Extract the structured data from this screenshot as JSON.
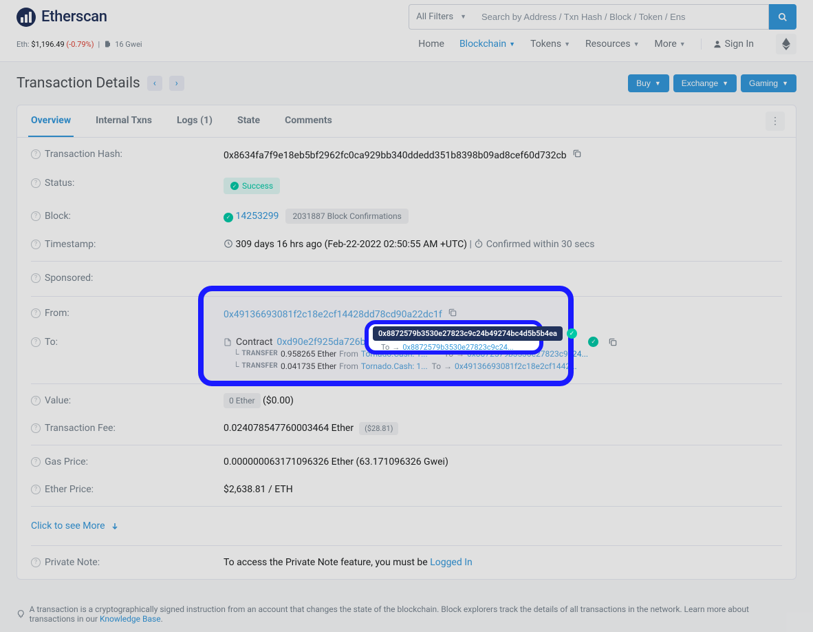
{
  "header": {
    "logo_text": "Etherscan",
    "filter_label": "All Filters",
    "search_placeholder": "Search by Address / Txn Hash / Block / Token / Ens",
    "eth_label": "Eth: ",
    "eth_price": "$1,196.49",
    "eth_change": "(-0.79%)",
    "gwei": "16 Gwei"
  },
  "nav": {
    "home": "Home",
    "blockchain": "Blockchain",
    "tokens": "Tokens",
    "resources": "Resources",
    "more": "More",
    "signin": "Sign In"
  },
  "page": {
    "title": "Transaction Details",
    "buy": "Buy",
    "exchange": "Exchange",
    "gaming": "Gaming"
  },
  "tabs": {
    "overview": "Overview",
    "internal": "Internal Txns",
    "logs": "Logs (1)",
    "state": "State",
    "comments": "Comments"
  },
  "labels": {
    "hash": "Transaction Hash:",
    "status": "Status:",
    "block": "Block:",
    "timestamp": "Timestamp:",
    "sponsored": "Sponsored:",
    "from": "From:",
    "to": "To:",
    "value": "Value:",
    "fee": "Transaction Fee:",
    "gas": "Gas Price:",
    "ether_price": "Ether Price:",
    "private_note": "Private Note:"
  },
  "values": {
    "hash": "0x8634fa7f9e18eb5bf2962fc0ca929bb340ddedd351b8398b09ad8cef60d732cb",
    "status": "Success",
    "block": "14253299",
    "confirmations": "2031887 Block Confirmations",
    "timestamp_main": "309 days 16 hrs ago (Feb-22-2022 02:50:55 AM +UTC)",
    "confirmed_within": "Confirmed within 30 secs",
    "from": "0x49136693081f2c18e2cf14428dd78cd90a22dc1f",
    "contract_label": "Contract",
    "contract_addr": "0xd90e2f925da726b50c4ed8d",
    "transfer1_amount": "0.958265 Ether",
    "transfer1_from_label": "From",
    "transfer1_from": "Tornado.Cash: 1...",
    "transfer1_to_label": "To",
    "transfer1_to": "0x8872579b3530e27823c9c24...",
    "transfer2_amount": "0.041735 Ether",
    "transfer2_from": "Tornado.Cash: 1...",
    "transfer2_to": "0x49136693081f2c18e2cf1442...",
    "tooltip_addr": "0x8872579b3530e27823c9c24b49274bc4d5b5b4ea",
    "value_eth": "0 Ether",
    "value_usd": "($0.00)",
    "fee": "0.024078547760003464 Ether",
    "fee_usd": "($28.81)",
    "gas": "0.000000063171096326 Ether (63.171096326 Gwei)",
    "eth_price": "$2,638.81 / ETH",
    "see_more": "Click to see More",
    "private_note_text": "To access the Private Note feature, you must be ",
    "logged_in": "Logged In",
    "transfer_keyword": "TRANSFER"
  },
  "footer": {
    "text": "A transaction is a cryptographically signed instruction from an account that changes the state of the blockchain. Block explorers track the details of all transactions in the network. Learn more about transactions in our ",
    "link": "Knowledge Base"
  }
}
